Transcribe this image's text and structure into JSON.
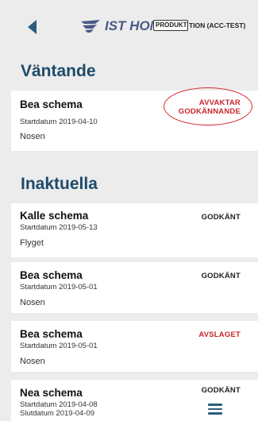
{
  "header": {
    "logo_text": "IST HOME",
    "env_badge": "PRODUKTION",
    "env_text": "TION (ACC-TEST)"
  },
  "sections": [
    {
      "title": "Väntande",
      "items": [
        {
          "title": "Bea schema",
          "start": "Startdatum 2019-04-10",
          "location": "Nosen",
          "status_lines": [
            "AVVAKTAR",
            "GODKÄNNANDE"
          ]
        }
      ]
    },
    {
      "title": "Inaktuella",
      "items": [
        {
          "title": "Kalle schema",
          "start": "Startdatum 2019-05-13",
          "location": "Flyget",
          "status": "GODKÄNT"
        },
        {
          "title": "Bea schema",
          "start": "Startdatum 2019-05-01",
          "location": "Nosen",
          "status": "GODKÄNT"
        },
        {
          "title": "Bea schema",
          "start": "Startdatum 2019-05-01",
          "location": "Nosen",
          "status": "AVSLAGET"
        },
        {
          "title": "Nea schema",
          "start": "Startdatum 2019-04-08",
          "end": "Slutdatum 2019-04-09",
          "status": "GODKÄNT"
        }
      ]
    }
  ],
  "colors": {
    "section_title": "#1f4a6a",
    "status_warn": "#c8262b",
    "status_ok": "#222222",
    "logo": "#4a5a86"
  },
  "icons": {
    "back": "chevron-left-icon",
    "logo": "ist-wing-logo-icon",
    "menu": "hamburger-menu-icon"
  }
}
